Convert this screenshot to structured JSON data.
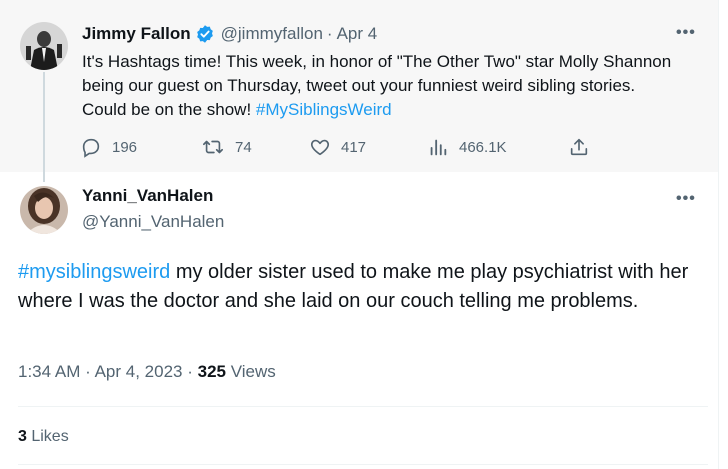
{
  "parent": {
    "author_name": "Jimmy Fallon",
    "author_handle": "@jimmyfallon",
    "separator": "·",
    "date": "Apr 4",
    "text_before": "It's Hashtags time! This week, in honor of \"The Other Two\" star Molly Shannon being our guest on Thursday, tweet out your funniest weird sibling stories. Could be on the show! ",
    "hashtag": "#MySiblingsWeird",
    "more_icon": "more-dots-icon",
    "actions": {
      "replies": "196",
      "retweets": "74",
      "likes": "417",
      "views": "466.1K"
    }
  },
  "reply": {
    "author_name": "Yanni_VanHalen",
    "author_handle": "@Yanni_VanHalen",
    "hashtag": "#mysiblingsweird",
    "text_after": " my older sister used to make me play psychiatrist with her where I was the doctor and she laid on our couch telling me problems.",
    "time": "1:34 AM",
    "dot1": "·",
    "date": "Apr 4, 2023",
    "dot2": "·",
    "views_count": "325",
    "views_label": " Views",
    "likes_count": "3",
    "likes_label": " Likes"
  },
  "colors": {
    "link": "#1d9bf0",
    "muted": "#536471",
    "verified": "#1d9bf0"
  }
}
